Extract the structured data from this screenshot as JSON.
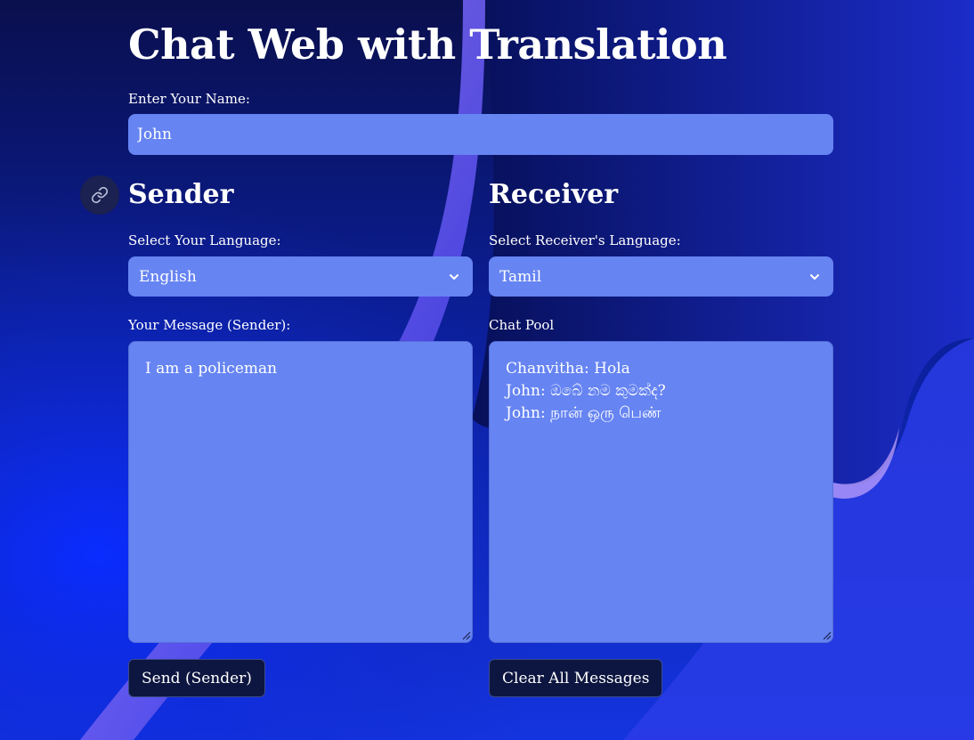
{
  "page": {
    "title": "Chat Web with Translation"
  },
  "name_field": {
    "label": "Enter Your Name:",
    "value": "John"
  },
  "sender": {
    "heading": "Sender",
    "language_label": "Select Your Language:",
    "language_value": "English",
    "message_label": "Your Message (Sender):",
    "message_value": "I am a policeman",
    "send_label": "Send (Sender)"
  },
  "receiver": {
    "heading": "Receiver",
    "language_label": "Select Receiver's Language:",
    "language_value": "Tamil",
    "chat_label": "Chat Pool",
    "chat_lines": [
      "Chanvitha: Hola",
      "John: ඔබේ නම කුමක්ද?",
      "John: நான் ஒரு பெண்"
    ],
    "clear_label": "Clear All Messages"
  },
  "icons": {
    "anchor": "link-icon",
    "select_arrow": "chevron-down-icon",
    "resize": "resize-grip-icon"
  },
  "colors": {
    "field_bg": "#6684f2",
    "button_bg": "#0d1640",
    "text": "#ffffff"
  }
}
